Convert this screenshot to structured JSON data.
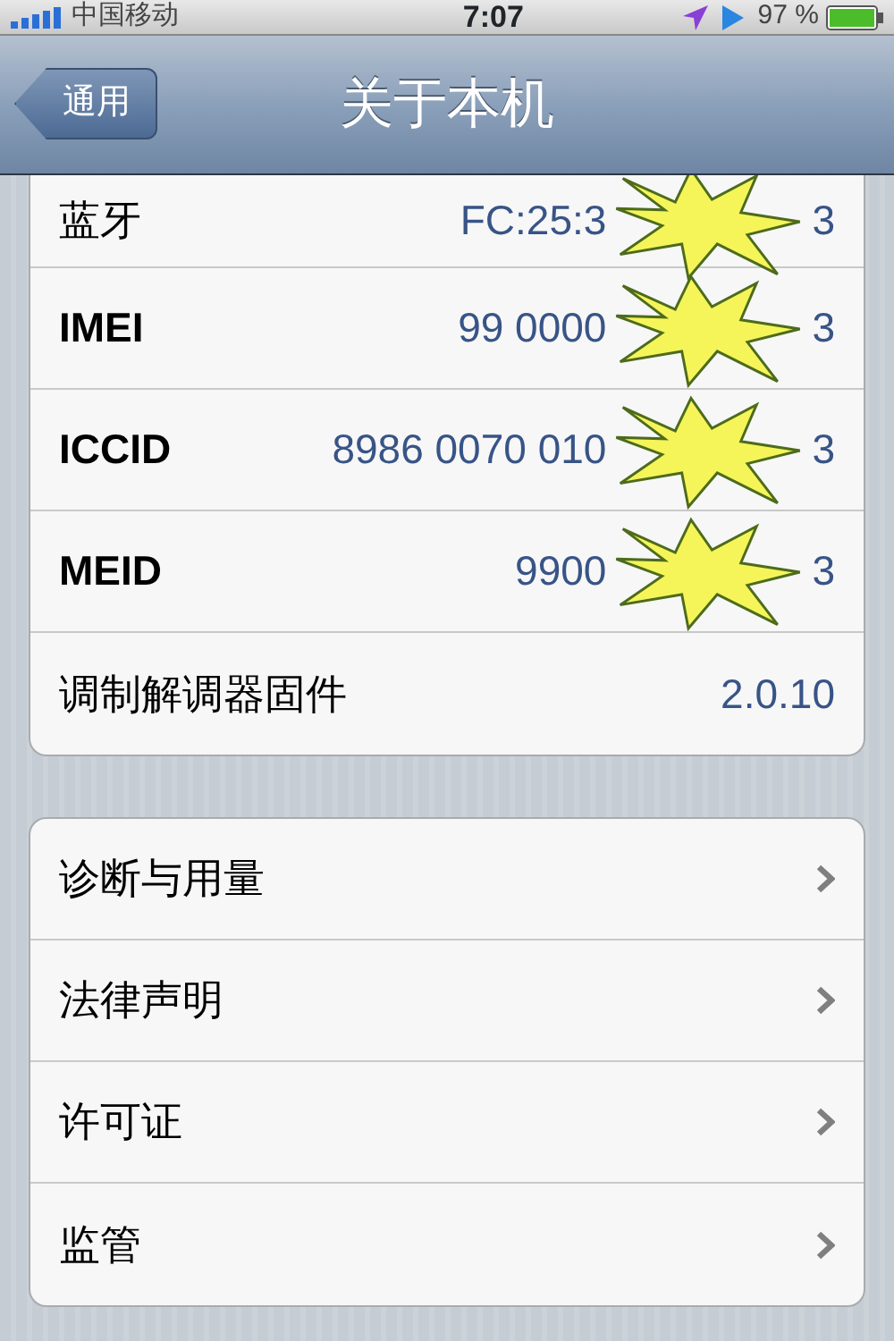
{
  "status_bar": {
    "carrier": "中国移动",
    "time": "7:07",
    "battery": "97 %"
  },
  "nav_bar": {
    "back": "通用",
    "title": "关于本机"
  },
  "info_rows": [
    {
      "label": "蓝牙",
      "value_parts": [
        "FC:25:3",
        "3"
      ],
      "redacted": true
    },
    {
      "label": "IMEI",
      "value_parts": [
        "99 0000",
        "3"
      ],
      "redacted": true
    },
    {
      "label": "ICCID",
      "value_parts": [
        "8986 0070 010",
        "3"
      ],
      "redacted": true
    },
    {
      "label": "MEID",
      "value_parts": [
        "9900",
        "3"
      ],
      "redacted": true
    },
    {
      "label": "调制解调器固件",
      "value_parts": [
        "2.0.10"
      ],
      "redacted": false
    }
  ],
  "link_rows": [
    {
      "label": "诊断与用量"
    },
    {
      "label": "法律声明"
    },
    {
      "label": "许可证"
    },
    {
      "label": "监管"
    }
  ]
}
